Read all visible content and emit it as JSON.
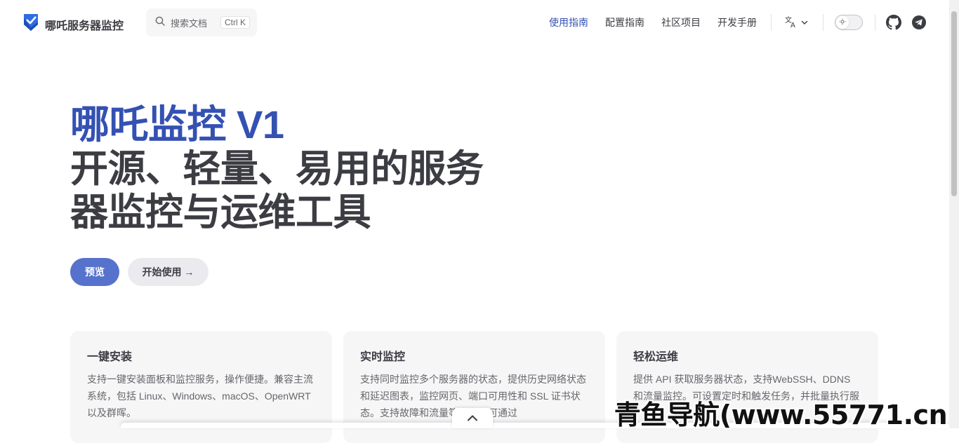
{
  "nav": {
    "title": "哪吒服务器监控",
    "search": {
      "placeholder": "搜索文档",
      "shortcut": "Ctrl K"
    },
    "links": [
      {
        "label": "使用指南",
        "active": true
      },
      {
        "label": "配置指南",
        "active": false
      },
      {
        "label": "社区项目",
        "active": false
      },
      {
        "label": "开发手册",
        "active": false
      }
    ],
    "icons": [
      "language-icon",
      "chevron-down-icon",
      "theme-toggle",
      "sun-icon",
      "github-icon",
      "telegram-icon"
    ]
  },
  "hero": {
    "name": "哪吒监控 V1",
    "text": "开源、轻量、易用的服务器监控与运维工具",
    "actions": [
      {
        "label": "预览",
        "style": "brand"
      },
      {
        "label": "开始使用 →",
        "style": "alt"
      }
    ]
  },
  "features": [
    {
      "title": "一键安装",
      "details": "支持一键安装面板和监控服务，操作便捷。兼容主流系统，包括 Linux、Windows、macOS、OpenWRT 以及群晖。"
    },
    {
      "title": "实时监控",
      "details": "支持同时监控多个服务器的状态，提供历史网络状态和延迟图表，监控网页、端口可用性和 SSL 证书状态。支持故障和流量等告警，可通过"
    },
    {
      "title": "轻松运维",
      "details": "提供 API 获取服务器状态，支持WebSSH、DDNS 和流量监控。可设置定时和触发任务，并批量执行服"
    }
  ],
  "watermark": "青鱼导航(www.55771.cn)",
  "colors": {
    "brand": "#3451b2",
    "button": "#5672cd",
    "text": "#3c3c43",
    "muted": "#67676c",
    "card": "#f6f6f7"
  }
}
